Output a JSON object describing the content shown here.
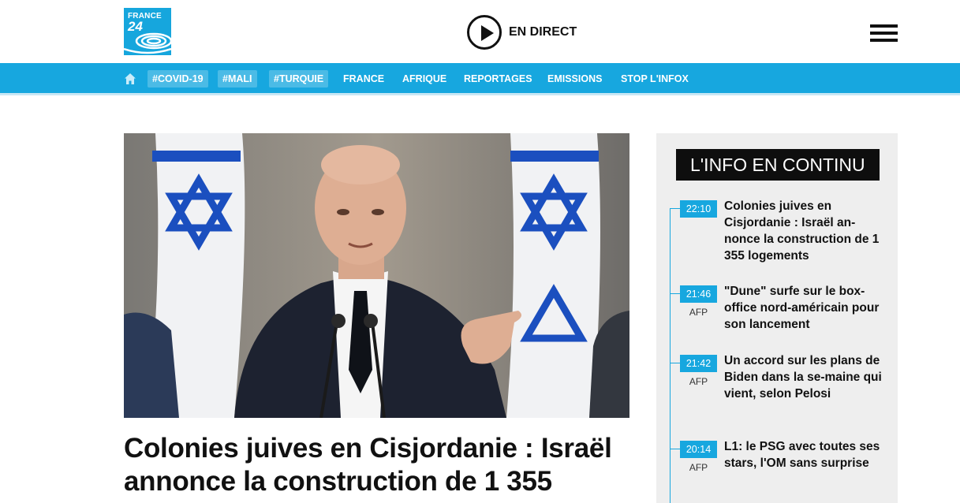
{
  "header": {
    "logo": {
      "line1": "FRANCE",
      "line2": "24"
    },
    "live_label": "EN DIRECT",
    "menu_icon": "hamburger-icon"
  },
  "nav": {
    "home_icon": "home-icon",
    "tags": [
      "#COVID-19",
      "#MALI",
      "#TURQUIE"
    ],
    "items": [
      "FRANCE",
      "AFRIQUE",
      "REPORTAGES",
      "EMISSIONS",
      "STOP L'INFOX"
    ]
  },
  "main": {
    "image_alt": "Man in dark suit speaking at microphones in front of Israeli flags",
    "headline": "Colonies juives en Cisjordanie : Israël annonce la construction de 1 355"
  },
  "sidebar": {
    "title": "L'INFO EN CONTINU",
    "entries": [
      {
        "time": "22:10",
        "source": "",
        "text": "Colonies juives en Cisjordanie : Israël an-nonce la construction de 1 355 logements"
      },
      {
        "time": "21:46",
        "source": "AFP",
        "text": "\"Dune\" surfe sur le box-office nord-américain pour son lancement"
      },
      {
        "time": "21:42",
        "source": "AFP",
        "text": "Un accord sur les plans de Biden dans la se-maine qui vient, selon Pelosi"
      },
      {
        "time": "20:14",
        "source": "AFP",
        "text": "L1: le PSG avec toutes ses stars, l'OM sans surprise"
      }
    ]
  },
  "colors": {
    "brand": "#17a7df",
    "tag_bg": "#4bbbe6",
    "sidebar_bg": "#eeeeee",
    "title_bg": "#0e0e0e"
  }
}
